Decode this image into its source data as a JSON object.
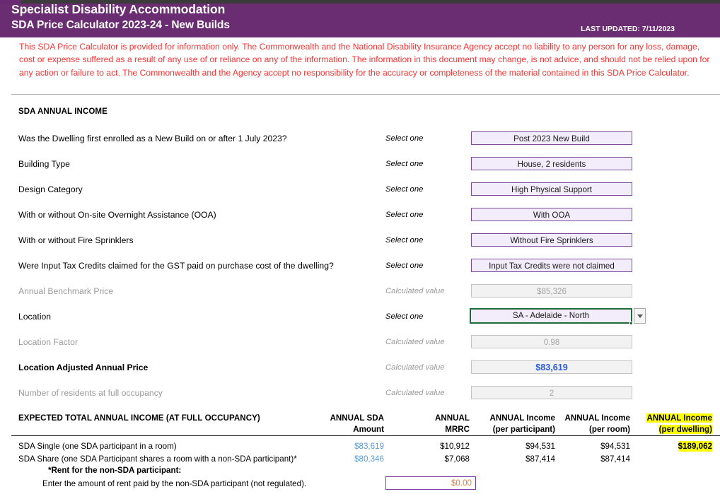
{
  "header": {
    "title_line1": "Specialist Disability Accommodation",
    "title_line2": "SDA Price Calculator 2023-24 - New Builds",
    "last_updated": "LAST UPDATED: 7/11/2023",
    "brand_purple": "#6b2d72"
  },
  "disclaimer": {
    "text": "This SDA Price Calculator is provided for information only.  The Commonwealth and the National Disability Insurance Agency accept no liability to any person for any loss, damage, cost or expense suffered as a result of any use of or reliance on any of the information.  The information in this document may change, is not advice, and should not be relied upon for any action or failure to act. The Commonwealth and the Agency accept no responsibility for the accuracy or completeness of the material contained in this SDA Price Calculator.",
    "color": "#ff3333"
  },
  "section": {
    "title": "SDA ANNUAL INCOME"
  },
  "form": {
    "hint_select": "Select one",
    "hint_calculated": "Calculated value",
    "rows": [
      {
        "label": "Was the Dwelling first enrolled as a New Build on or after 1 July 2023?",
        "hint": "Select one",
        "value": "Post 2023 New Build",
        "kind": "select"
      },
      {
        "label": "Building Type",
        "hint": "Select one",
        "value": "House, 2 residents",
        "kind": "select"
      },
      {
        "label": "Design Category",
        "hint": "Select one",
        "value": "High Physical Support",
        "kind": "select"
      },
      {
        "label": "With or without On-site Overnight Assistance (OOA)",
        "hint": "Select one",
        "value": "With OOA",
        "kind": "select"
      },
      {
        "label": "With or without Fire Sprinklers",
        "hint": "Select one",
        "value": "Without Fire Sprinklers",
        "kind": "select"
      },
      {
        "label": "Were Input Tax Credits claimed for the GST paid on purchase cost of the dwelling?",
        "hint": "Select one",
        "value": "Input Tax Credits were not claimed",
        "kind": "select"
      },
      {
        "label": "Annual Benchmark Price",
        "hint": "Calculated value",
        "value": "$85,326",
        "kind": "calc"
      },
      {
        "label": "Location",
        "hint": "Select one",
        "value": "SA - Adelaide - North",
        "kind": "combo"
      },
      {
        "label": "Location Factor",
        "hint": "Calculated value",
        "value": "0.98",
        "kind": "calc"
      },
      {
        "label": "Location Adjusted Annual Price",
        "hint": "Calculated value",
        "value": "$83,619",
        "kind": "calc-accent"
      },
      {
        "label": "Number of residents at full occupancy",
        "hint": "Calculated value",
        "value": "2",
        "kind": "calc"
      }
    ]
  },
  "results": {
    "title": "EXPECTED TOTAL ANNUAL INCOME (AT FULL OCCUPANCY)",
    "columns": [
      {
        "line1": "ANNUAL SDA",
        "line2": "Amount",
        "highlight": false
      },
      {
        "line1": "ANNUAL",
        "line2": "MRRC",
        "highlight": false
      },
      {
        "line1": "ANNUAL Income",
        "line2": "(per participant)",
        "highlight": false
      },
      {
        "line1": "ANNUAL Income",
        "line2": "(per room)",
        "highlight": false
      },
      {
        "line1": "ANNUAL Income",
        "line2": "(per dwelling)",
        "highlight": true
      }
    ],
    "rows": [
      {
        "label": "SDA Single (one SDA participant in a room)",
        "sda_amount": "$83,619",
        "mrrc": "$10,912",
        "per_participant": "$94,531",
        "per_room": "$94,531",
        "per_dwelling": "$189,062"
      },
      {
        "label": "SDA Share (one SDA Participant shares a room with a non-SDA participant)*",
        "sda_amount": "$80,346",
        "mrrc": "$7,068",
        "per_participant": "$87,414",
        "per_room": "$87,414",
        "per_dwelling": ""
      }
    ],
    "note_bold": "*Rent for the non-SDA participant:",
    "note_plain": "Enter the amount of rent paid by the non-SDA participant (not regulated).",
    "rent_value": "$0.00",
    "highlight_color": "#ffff00"
  }
}
